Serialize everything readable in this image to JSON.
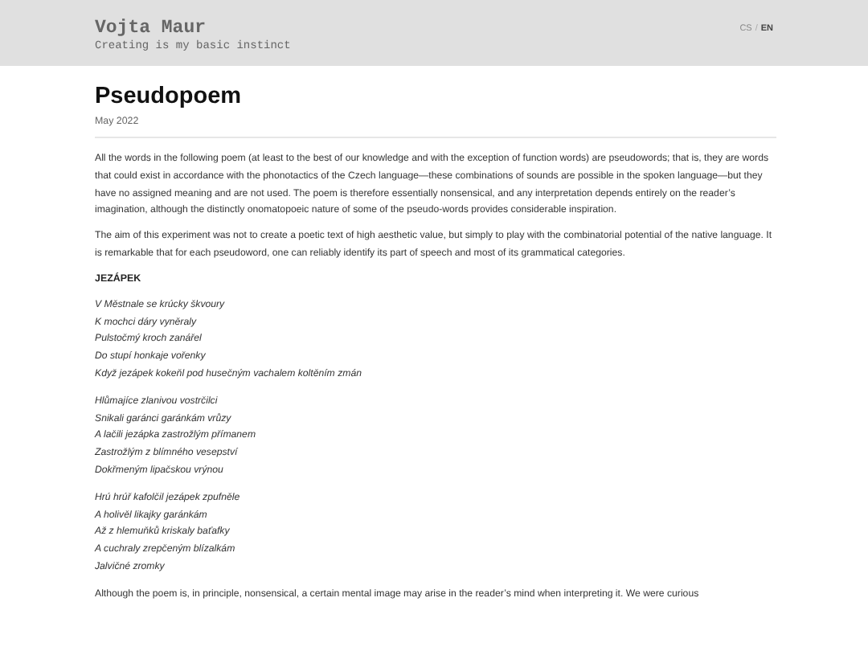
{
  "header": {
    "site_title": "Vojta Maur",
    "tagline": "Creating is my basic instinct",
    "languages": [
      {
        "label": "CS",
        "selected": false
      },
      {
        "label": "EN",
        "selected": true
      }
    ],
    "separator": "/"
  },
  "article": {
    "title": "Pseudopoem",
    "date": "May 2022",
    "intro": [
      "All the words in the following poem (at least to the best of our knowledge and with the exception of function words) are pseudowords; that is, they are words that could exist in accordance with the phonotactics of the Czech language—these combinations of sounds are possible in the spoken language—but they have no assigned meaning and are not used. The poem is therefore essentially nonsensical, and any interpretation depends entirely on the reader’s imagination, although the distinctly onomatopoeic nature of some of the pseudo-words provides considerable inspiration.",
      "The aim of this experiment was not to create a poetic text of high aesthetic value, but simply to play with the combinatorial potential of the native language. It is remarkable that for each pseudoword, one can reliably identify its part of speech and most of its grammatical categories."
    ],
    "poem_title": "JEZÁPEK",
    "stanzas": [
      [
        "V Městnale se krúcky škvoury",
        "K mochci dáry vyněraly",
        "Pulstočmý kroch zanářel",
        "Do stupí honkaje vořenky",
        "Když jezápek kokeňl pod husečným vachalem koltěním zmán"
      ],
      [
        "Hlůmajíce zlanivou vostrčilci",
        "Snikali garánci garánkám vrůzy",
        "A lačili jezápka zastrožlým přímanem",
        "Zastrožlým z blímného vesepství",
        "Dokřmeným lipačskou vrýnou"
      ],
      [
        "Hrú hrúř kafolčil jezápek zpufněle",
        "A holivěl likajky garánkám",
        "Až z hlemuňků kriskaly baťafky",
        "A cuchraly zrepčeným blízalkám",
        "Jalvičné zromky"
      ]
    ],
    "outro": "Although the poem is, in principle, nonsensical, a certain mental image may arise in the reader’s mind when interpreting it. We were curious"
  }
}
